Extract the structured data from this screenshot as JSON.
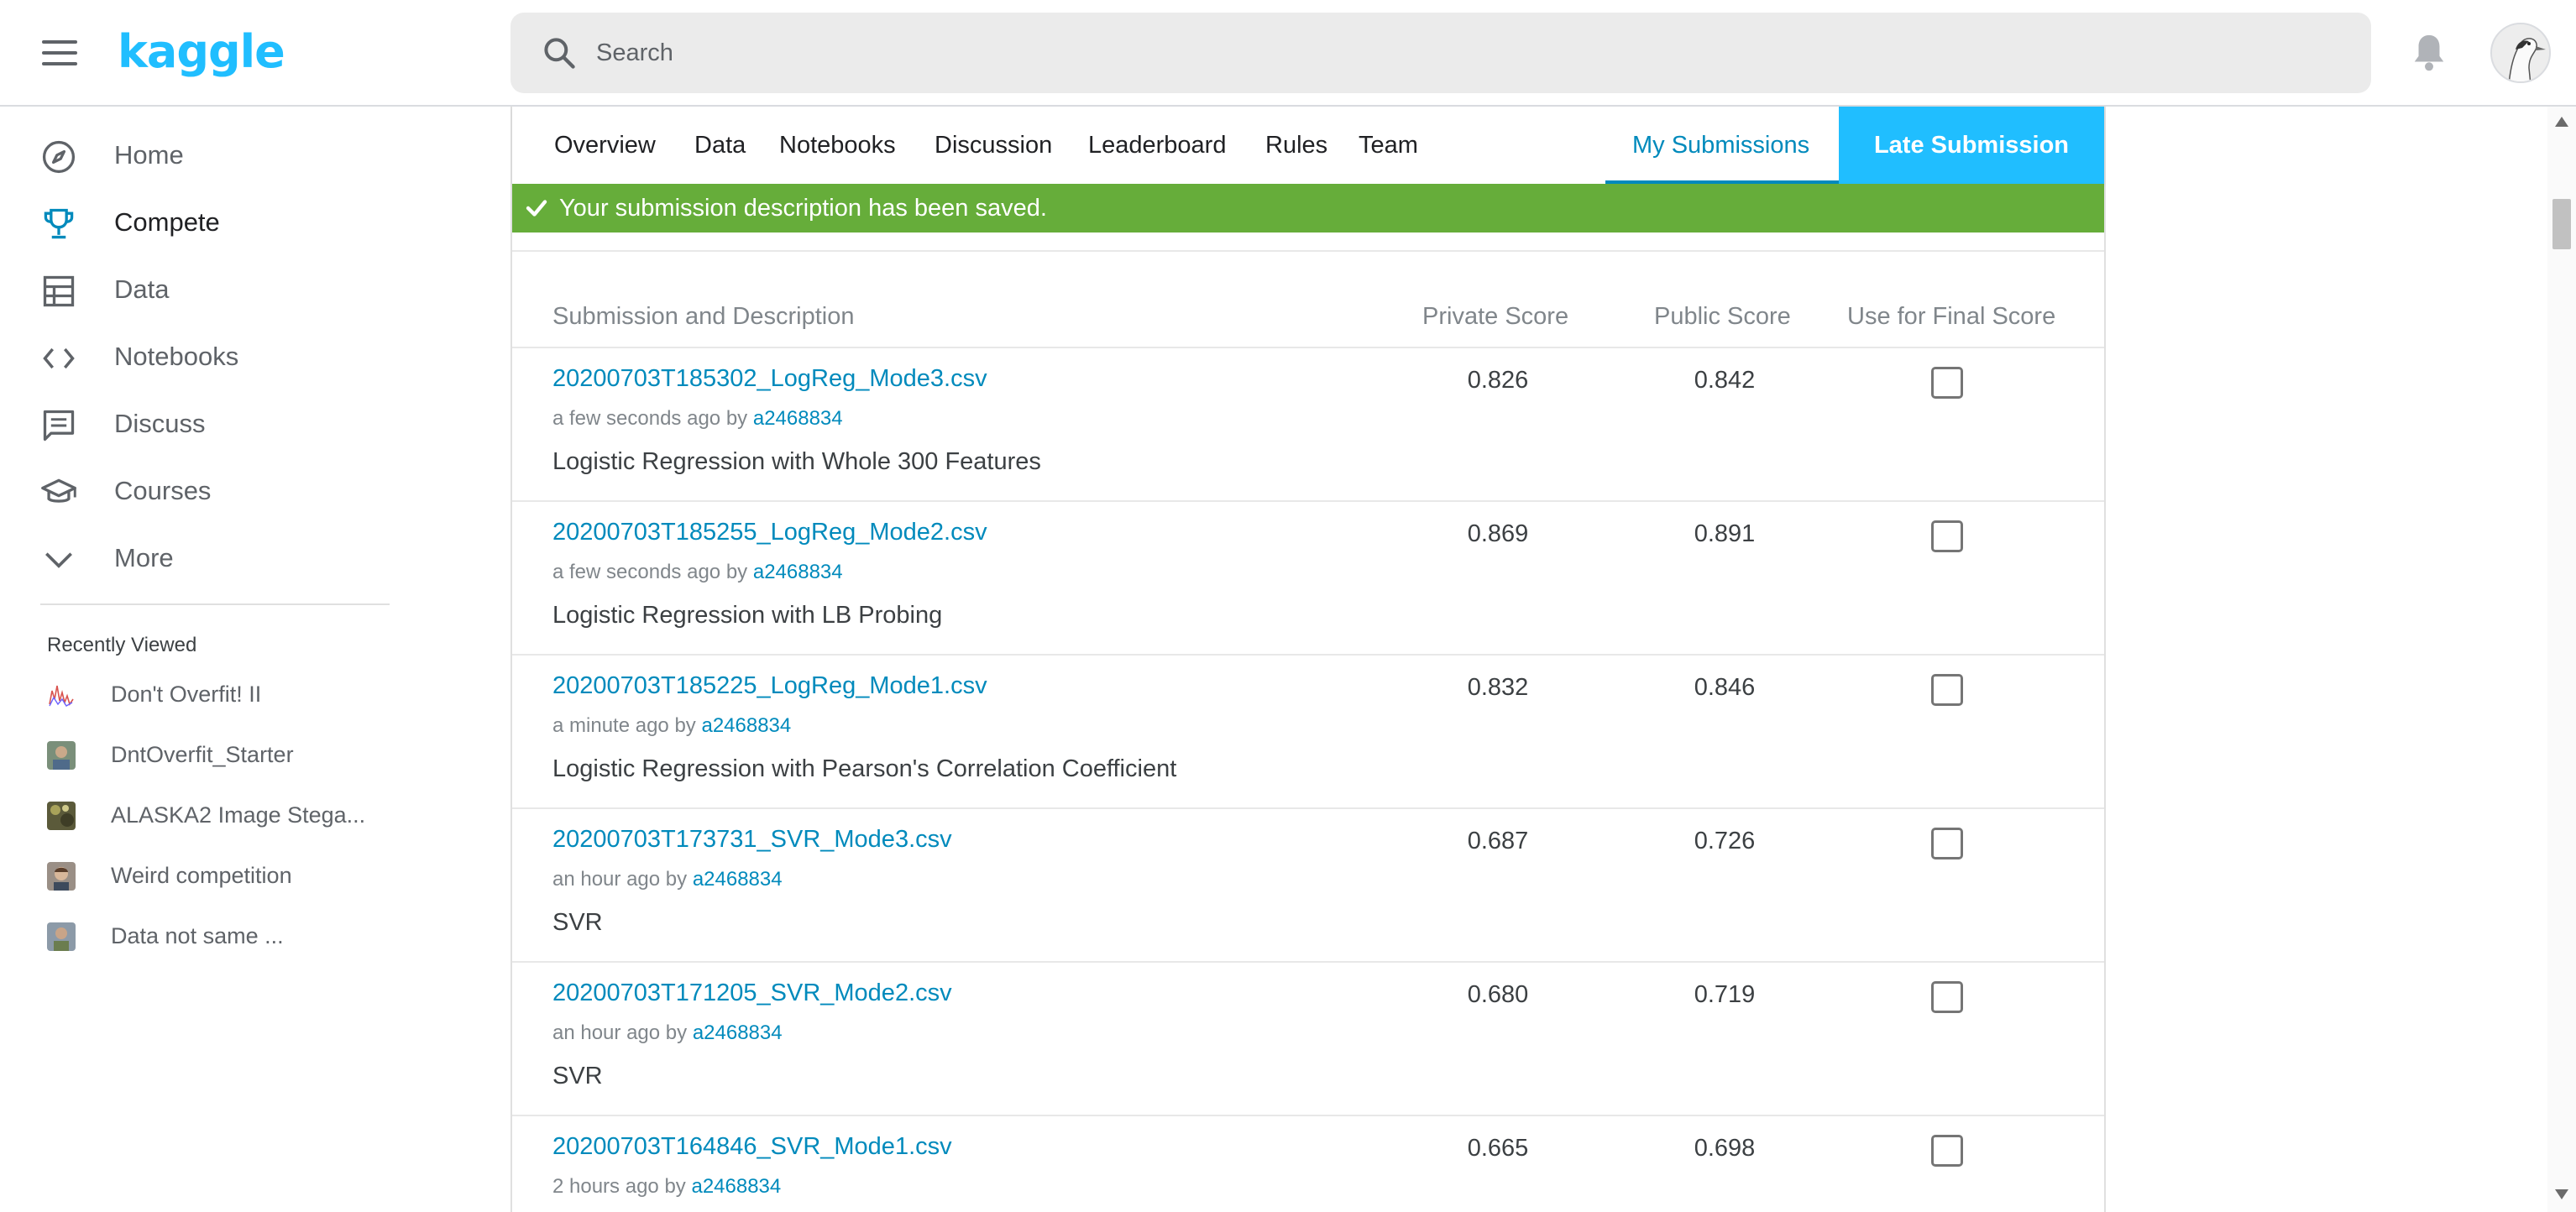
{
  "header": {
    "logo_text": "kaggle",
    "brand_color": "#20beff",
    "search": {
      "placeholder": "Search",
      "value": ""
    },
    "icons": [
      "menu-icon",
      "search-icon",
      "bell-icon",
      "avatar"
    ]
  },
  "sidebar": {
    "items": [
      {
        "label": "Home",
        "icon": "compass-icon",
        "active": false
      },
      {
        "label": "Compete",
        "icon": "trophy-icon",
        "active": true
      },
      {
        "label": "Data",
        "icon": "table-icon",
        "active": false
      },
      {
        "label": "Notebooks",
        "icon": "code-icon",
        "active": false
      },
      {
        "label": "Discuss",
        "icon": "comment-icon",
        "active": false
      },
      {
        "label": "Courses",
        "icon": "graduation-cap-icon",
        "active": false
      },
      {
        "label": "More",
        "icon": "chevron-down-icon",
        "active": false
      }
    ],
    "recently_viewed_title": "Recently Viewed",
    "recent": [
      {
        "label": "Don't Overfit! II"
      },
      {
        "label": "DntOverfit_Starter"
      },
      {
        "label": "ALASKA2 Image Stega..."
      },
      {
        "label": "Weird competition"
      },
      {
        "label": "Data not same ..."
      }
    ]
  },
  "tabs": {
    "items": [
      "Overview",
      "Data",
      "Notebooks",
      "Discussion",
      "Leaderboard",
      "Rules",
      "Team"
    ],
    "selected": "My Submissions",
    "late_submission": "Late Submission",
    "accent_color": "#008abc"
  },
  "alert": {
    "text": "Your submission description has been saved.",
    "color": "#66ad3a"
  },
  "table": {
    "headers": {
      "submission": "Submission and Description",
      "private": "Private Score",
      "public": "Public Score",
      "final": "Use for Final Score"
    },
    "rows": [
      {
        "file": "20200703T185302_LogReg_Mode3.csv",
        "time": "a few seconds ago",
        "by": "by",
        "user": "a2468834",
        "description": "Logistic Regression with Whole 300 Features",
        "private": "0.826",
        "public": "0.842",
        "final": false
      },
      {
        "file": "20200703T185255_LogReg_Mode2.csv",
        "time": "a few seconds ago",
        "by": "by",
        "user": "a2468834",
        "description": "Logistic Regression with LB Probing",
        "private": "0.869",
        "public": "0.891",
        "final": false
      },
      {
        "file": "20200703T185225_LogReg_Mode1.csv",
        "time": "a minute ago",
        "by": "by",
        "user": "a2468834",
        "description": "Logistic Regression with Pearson's Correlation Coefficient",
        "private": "0.832",
        "public": "0.846",
        "final": false
      },
      {
        "file": "20200703T173731_SVR_Mode3.csv",
        "time": "an hour ago",
        "by": "by",
        "user": "a2468834",
        "description": "SVR",
        "private": "0.687",
        "public": "0.726",
        "final": false
      },
      {
        "file": "20200703T171205_SVR_Mode2.csv",
        "time": "an hour ago",
        "by": "by",
        "user": "a2468834",
        "description": "SVR",
        "private": "0.680",
        "public": "0.719",
        "final": false
      },
      {
        "file": "20200703T164846_SVR_Mode1.csv",
        "time": "2 hours ago",
        "by": "by",
        "user": "a2468834",
        "description": "",
        "private": "0.665",
        "public": "0.698",
        "final": false
      }
    ]
  }
}
